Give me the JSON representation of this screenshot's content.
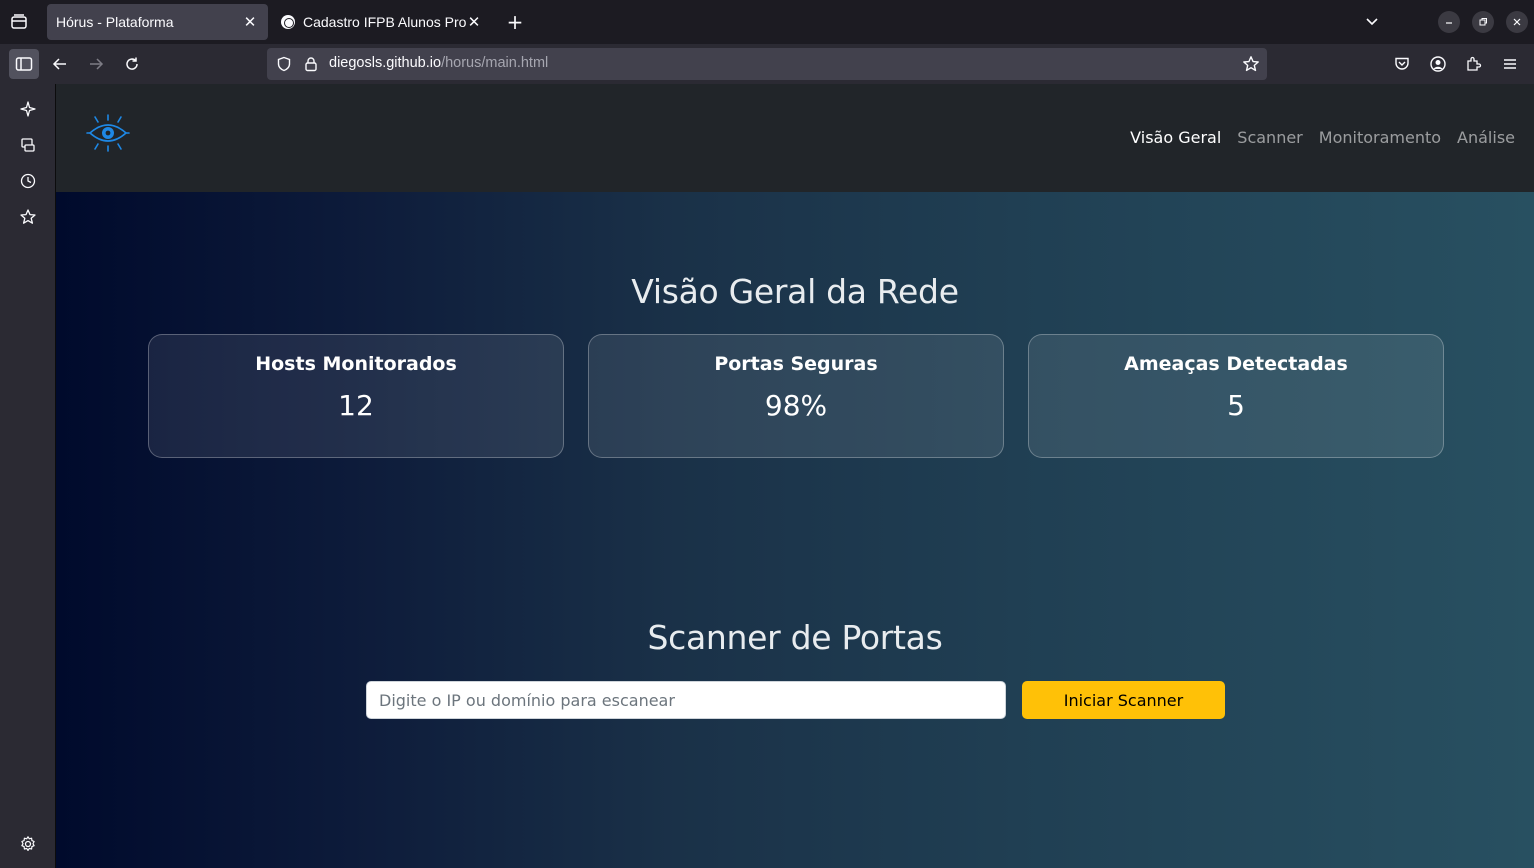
{
  "browser": {
    "tabs": [
      {
        "title": "Hórus - Plataforma",
        "active": true
      },
      {
        "title": "Cadastro IFPB Alunos Pro",
        "active": false
      }
    ],
    "url": {
      "host": "diegosls.github.io",
      "path": "/horus/main.html"
    }
  },
  "site": {
    "nav": [
      {
        "label": "Visão Geral",
        "active": true
      },
      {
        "label": "Scanner",
        "active": false
      },
      {
        "label": "Monitoramento",
        "active": false
      },
      {
        "label": "Análise",
        "active": false
      }
    ],
    "overview": {
      "title": "Visão Geral da Rede",
      "cards": [
        {
          "label": "Hosts Monitorados",
          "value": "12"
        },
        {
          "label": "Portas Seguras",
          "value": "98%"
        },
        {
          "label": "Ameaças Detectadas",
          "value": "5"
        }
      ]
    },
    "scanner": {
      "title": "Scanner de Portas",
      "input_placeholder": "Digite o IP ou domínio para escanear",
      "button_label": "Iniciar Scanner"
    }
  },
  "colors": {
    "accent_button": "#ffc107",
    "logo": "#1e88e5",
    "header_bg": "#212529"
  }
}
